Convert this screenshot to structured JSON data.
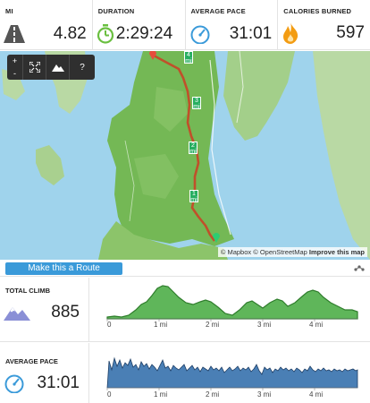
{
  "stats": [
    {
      "label": "MI",
      "value": "4.82",
      "icon": "road-icon"
    },
    {
      "label": "DURATION",
      "value": "2:29:24",
      "icon": "stopwatch-icon"
    },
    {
      "label": "AVERAGE PACE",
      "value": "31:01",
      "icon": "speedometer-icon"
    },
    {
      "label": "CALORIES BURNED",
      "value": "597",
      "icon": "flame-icon"
    }
  ],
  "map": {
    "controls": {
      "zoom_in": "+",
      "zoom_out": "-",
      "help": "?"
    },
    "mile_markers": [
      "4",
      "3",
      "2",
      "1"
    ],
    "attribution": {
      "mapbox": "© Mapbox",
      "osm": "© OpenStreetMap",
      "improve": "Improve this map"
    }
  },
  "route_button": "Make this a Route",
  "climb": {
    "label": "TOTAL CLIMB",
    "value": "885",
    "color": "#4caf50",
    "ticks": [
      "0",
      "1 mi",
      "2 mi",
      "3 mi",
      "4 mi"
    ]
  },
  "pace": {
    "label": "AVERAGE PACE",
    "value": "31:01",
    "color": "#4a7fb5",
    "ticks": [
      "0",
      "1 mi",
      "2 mi",
      "3 mi",
      "4 mi"
    ]
  },
  "colors": {
    "accent_green": "#6abf40",
    "accent_blue": "#3a9ad9",
    "flame": "#f39c12",
    "route": "#c0502a"
  }
}
